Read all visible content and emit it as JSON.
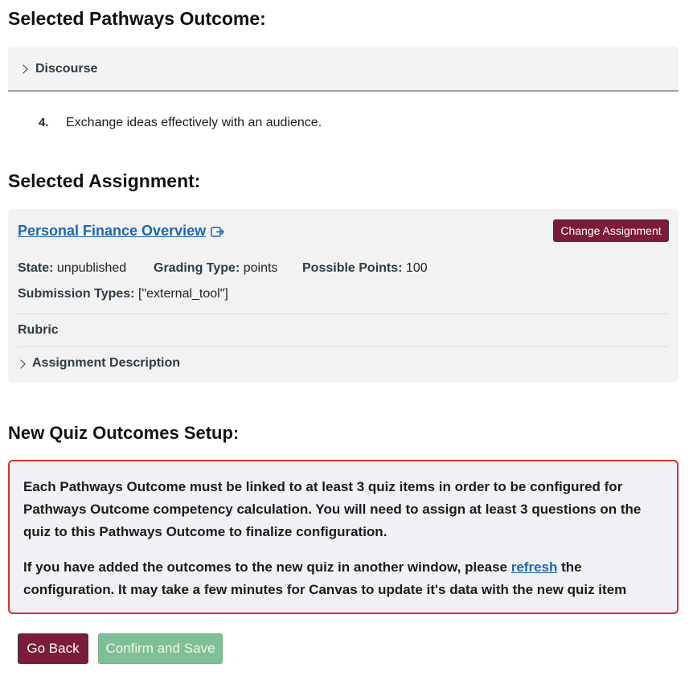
{
  "outcome_section": {
    "heading": "Selected Pathways Outcome:",
    "accordion_label": "Discourse",
    "item_number": "4.",
    "item_text": "Exchange ideas effectively with an audience."
  },
  "assignment_section": {
    "heading": "Selected Assignment:",
    "title": "Personal Finance Overview",
    "change_button": "Change Assignment",
    "state_label": "State:",
    "state_value": "unpublished",
    "grading_type_label": "Grading Type:",
    "grading_type_value": "points",
    "possible_points_label": "Possible Points:",
    "possible_points_value": "100",
    "submission_types_label": "Submission Types:",
    "submission_types_value": "[\"external_tool\"]",
    "rubric_label": "Rubric",
    "description_label": "Assignment Description"
  },
  "quiz_section": {
    "heading": "New Quiz Outcomes Setup:",
    "alert_paragraph_1": "Each Pathways Outcome must be linked to at least 3 quiz items in order to be configured for Pathways Outcome competency calculation. You will need to assign at least 3 questions on the quiz to this Pathways Outcome to finalize configuration.",
    "alert_paragraph_2_before": "If you have added the outcomes to the new quiz in another window, please ",
    "alert_link": "refresh",
    "alert_paragraph_2_after": " the configuration. It may take a few minutes for Canvas to update it's data with the new quiz item"
  },
  "actions": {
    "back_label": "Go Back",
    "confirm_label": "Confirm and Save"
  },
  "colors": {
    "primary_button": "#7d1c38",
    "disabled_confirm": "#7fbf95",
    "link": "#1f66ae",
    "alert_border": "#d93030"
  },
  "icons": {
    "accordion": "chevron-right-icon",
    "external": "external-link-icon"
  }
}
